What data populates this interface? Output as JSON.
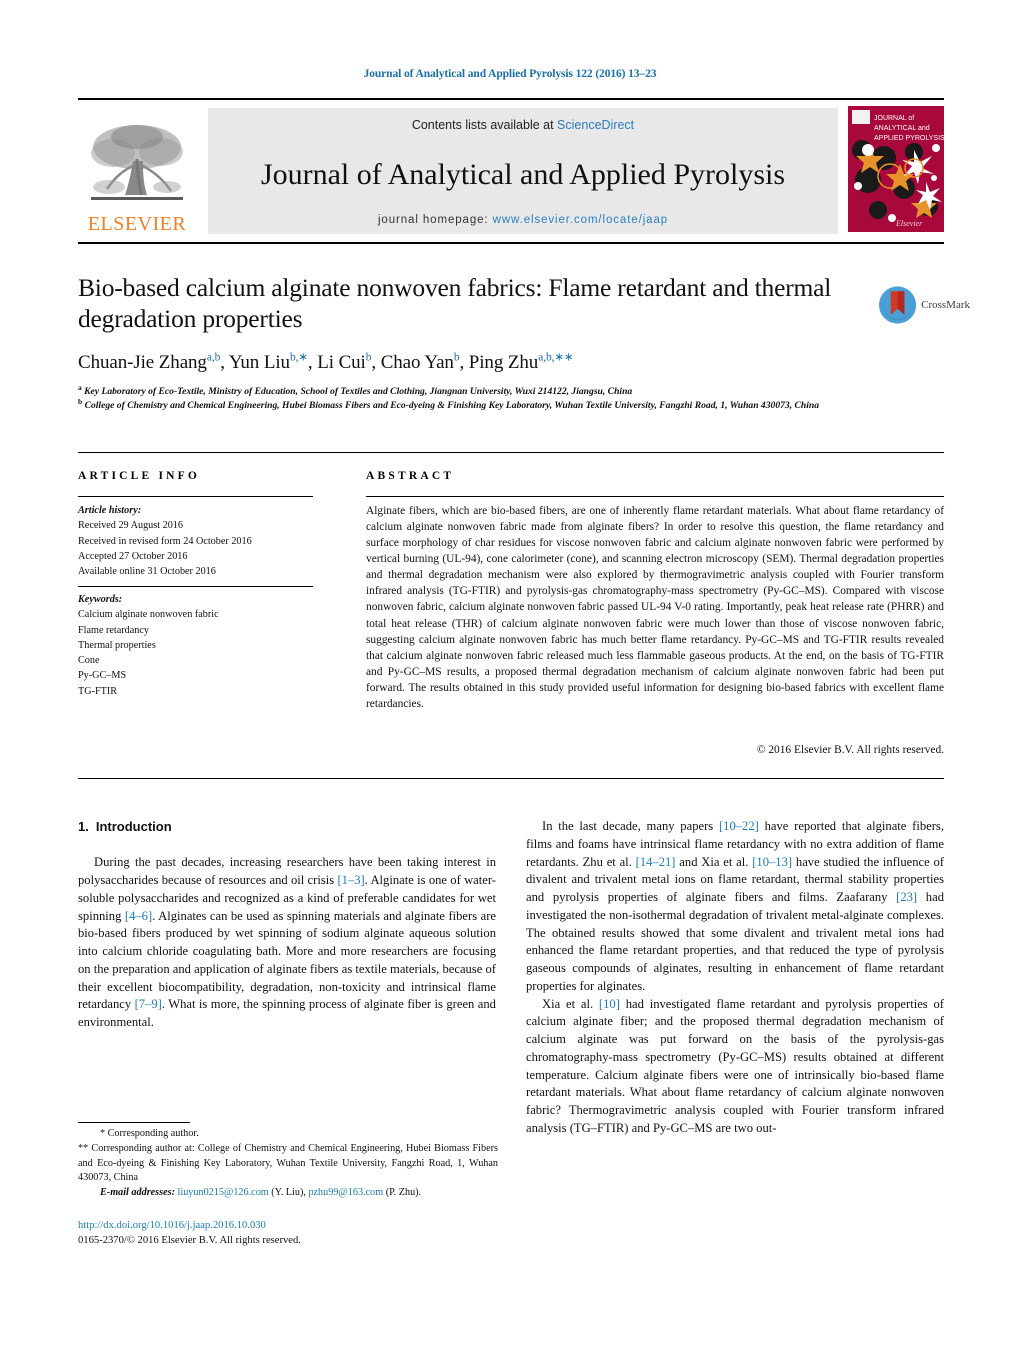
{
  "running_head": "Journal of Analytical and Applied Pyrolysis 122 (2016) 13–23",
  "masthead": {
    "contents_prefix": "Contents lists available at ",
    "contents_link": "ScienceDirect",
    "journal_title": "Journal of Analytical and Applied Pyrolysis",
    "homepage_label": "journal homepage: ",
    "homepage_url": "www.elsevier.com/locate/jaap",
    "publisher_wordmark": "ELSEVIER",
    "publisher_color": "#F57F20",
    "link_color": "#2b7fc4",
    "cover_title_line1": "JOURNAL of",
    "cover_title_line2": "ANALYTICAL and",
    "cover_title_line3": "APPLIED PYROLYSIS",
    "cover_bg_color": "#A8083A"
  },
  "title": "Bio-based calcium alginate nonwoven fabrics: Flame retardant and thermal degradation properties",
  "crossmark": {
    "label": "CrossMark"
  },
  "authors": [
    {
      "name": "Chuan-Jie Zhang",
      "marks": "a,b",
      "sep": ", "
    },
    {
      "name": "Yun Liu",
      "marks": "b,∗",
      "sep": ", "
    },
    {
      "name": "Li Cui",
      "marks": "b",
      "sep": ", "
    },
    {
      "name": "Chao Yan",
      "marks": "b",
      "sep": ", "
    },
    {
      "name": "Ping Zhu",
      "marks": "a,b,∗∗",
      "sep": ""
    }
  ],
  "affiliations": [
    {
      "mark": "a",
      "text": "Key Laboratory of Eco-Textile, Ministry of Education, School of Textiles and Clothing, Jiangnan University, Wuxi 214122, Jiangsu, China"
    },
    {
      "mark": "b",
      "text": "College of Chemistry and Chemical Engineering, Hubei Biomass Fibers and Eco-dyeing & Finishing Key Laboratory, Wuhan Textile University, Fangzhi Road, 1, Wuhan 430073, China"
    }
  ],
  "info_heading": "ARTICLE INFO",
  "abstract_heading": "ABSTRACT",
  "article_history": {
    "label": "Article history:",
    "lines": [
      "Received 29 August 2016",
      "Received in revised form 24 October 2016",
      "Accepted 27 October 2016",
      "Available online 31 October 2016"
    ]
  },
  "keywords": {
    "label": "Keywords:",
    "items": [
      "Calcium alginate nonwoven fabric",
      "Flame retardancy",
      "Thermal properties",
      "Cone",
      "Py-GC–MS",
      "TG-FTIR"
    ]
  },
  "abstract": "Alginate fibers, which are bio-based fibers, are one of inherently flame retardant materials. What about flame retardancy of calcium alginate nonwoven fabric made from alginate fibers? In order to resolve this question, the flame retardancy and surface morphology of char residues for viscose nonwoven fabric and calcium alginate nonwoven fabric were performed by vertical burning (UL-94), cone calorimeter (cone), and scanning electron microscopy (SEM). Thermal degradation properties and thermal degradation mechanism were also explored by thermogravimetric analysis coupled with Fourier transform infrared analysis (TG-FTIR) and pyrolysis-gas chromatography-mass spectrometry (Py-GC–MS). Compared with viscose nonwoven fabric, calcium alginate nonwoven fabric passed UL-94 V-0 rating. Importantly, peak heat release rate (PHRR) and total heat release (THR) of calcium alginate nonwoven fabric were much lower than those of viscose nonwoven fabric, suggesting calcium alginate nonwoven fabric has much better flame retardancy. Py-GC–MS and TG-FTIR results revealed that calcium alginate nonwoven fabric released much less flammable gaseous products. At the end, on the basis of TG-FTIR and Py-GC–MS results, a proposed thermal degradation mechanism of calcium alginate nonwoven fabric had been put forward. The results obtained in this study provided useful information for designing bio-based fabrics with excellent flame retardancies.",
  "copyright": "© 2016 Elsevier B.V. All rights reserved.",
  "section": {
    "number": "1.",
    "title": "Introduction"
  },
  "body_left": [
    "During the past decades, increasing researchers have been taking interest in polysaccharides because of resources and oil crisis [1–3]. Alginate is one of water-soluble polysaccharides and recognized as a kind of preferable candidates for wet spinning [4–6]. Alginates can be used as spinning materials and alginate fibers are bio-based fibers produced by wet spinning of sodium alginate aqueous solution into calcium chloride coagulating bath. More and more researchers are focusing on the preparation and application of alginate fibers as textile materials, because of their excellent biocompatibility, degradation, non-toxicity and intrinsical flame retardancy [7–9]. What is more, the spinning process of alginate fiber is green and environmental."
  ],
  "body_right": [
    "In the last decade, many papers [10–22] have reported that alginate fibers, films and foams have intrinsical flame retardancy with no extra addition of flame retardants. Zhu et al. [14–21] and Xia et al. [10–13] have studied the influence of divalent and trivalent metal ions on flame retardant, thermal stability properties and pyrolysis properties of alginate fibers and films. Zaafarany [23] had investigated the non-isothermal degradation of trivalent metal-alginate complexes. The obtained results showed that some divalent and trivalent metal ions had enhanced the flame retardant properties, and that reduced the type of pyrolysis gaseous compounds of alginates, resulting in enhancement of flame retardant properties for alginates.",
    "Xia et al. [10] had investigated flame retardant and pyrolysis properties of calcium alginate fiber; and the proposed thermal degradation mechanism of calcium alginate was put forward on the basis of the pyrolysis-gas chromatography-mass spectrometry (Py-GC–MS) results obtained at different temperature. Calcium alginate fibers were one of intrinsically bio-based flame retardant materials. What about flame retardancy of calcium alginate nonwoven fabric? Thermogravimetric analysis coupled with Fourier transform infrared analysis (TG–FTIR) and Py-GC–MS are two out-"
  ],
  "footnotes": {
    "line1": "* Corresponding author.",
    "line2": "** Corresponding author at: College of Chemistry and Chemical Engineering, Hubei Biomass Fibers and Eco-dyeing & Finishing Key Laboratory, Wuhan Textile University, Fangzhi Road, 1, Wuhan 430073, China",
    "email_label": "E-mail addresses:",
    "email1": "liuyun0215@126.com",
    "email1_owner": "(Y. Liu)",
    "email2": "pzhu99@163.com",
    "email2_owner": "(P. Zhu)."
  },
  "doi": {
    "url": "http://dx.doi.org/10.1016/j.jaap.2016.10.030",
    "issn_line": "0165-2370/© 2016 Elsevier B.V. All rights reserved."
  }
}
